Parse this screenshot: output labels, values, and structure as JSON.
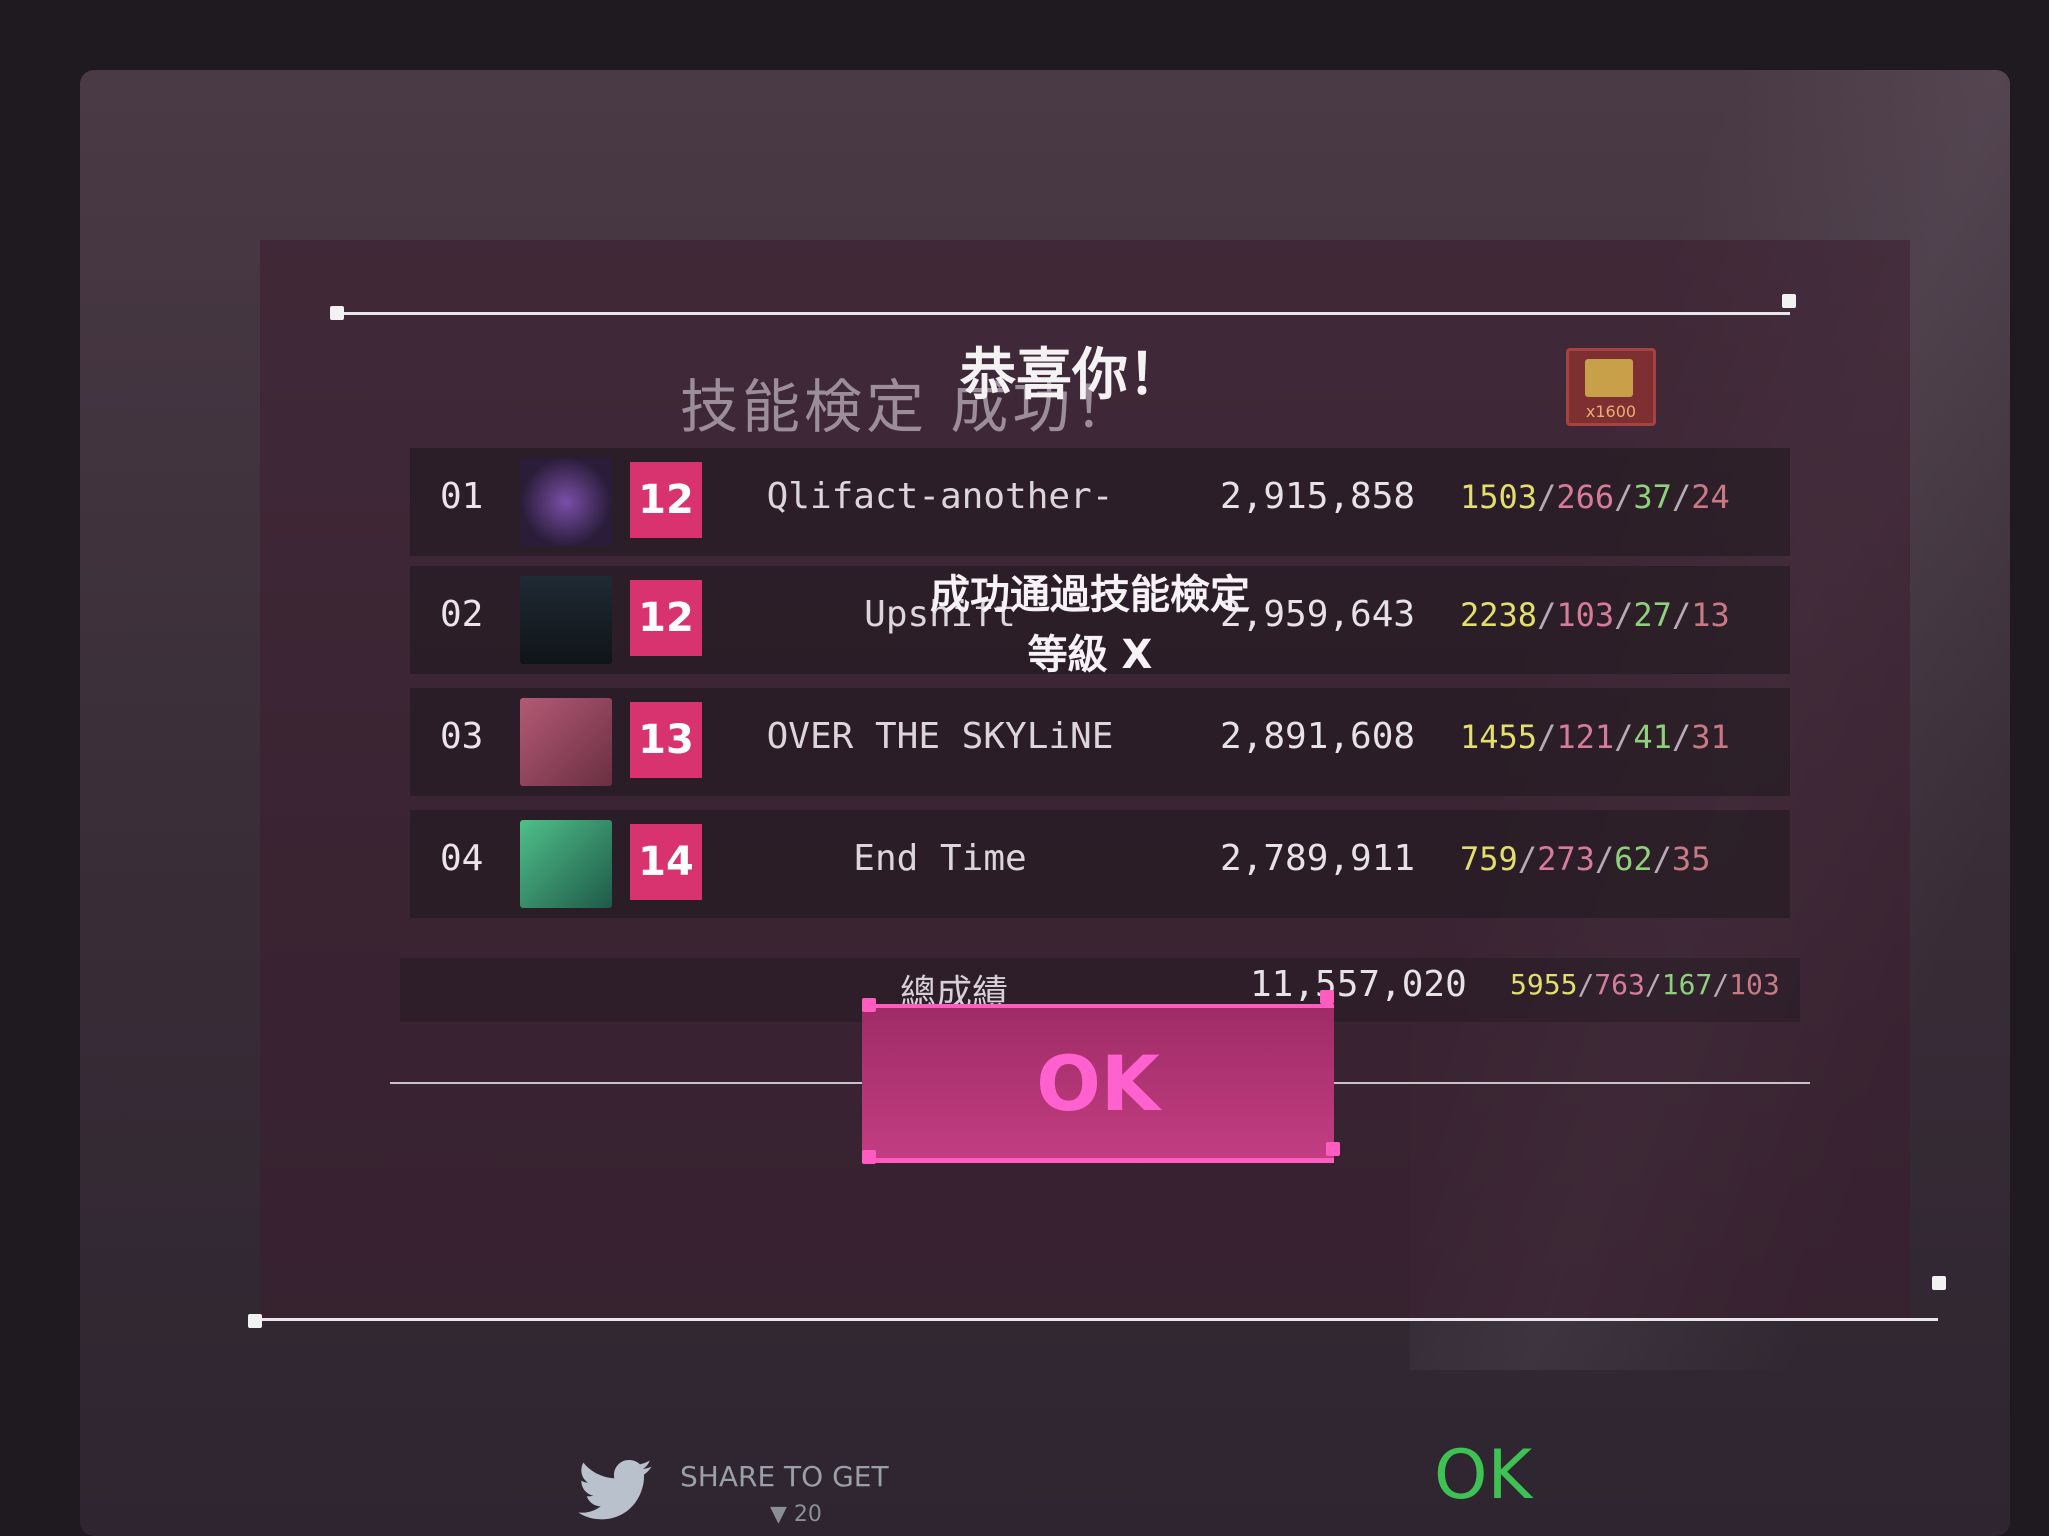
{
  "title_bg": "技能検定 成功！",
  "title_fg": "恭喜你！",
  "coin_label": "x1600",
  "message": {
    "line1": "成功通過技能檢定",
    "line2": "等級 X"
  },
  "rows": [
    {
      "rank": "01",
      "level": "12",
      "song": "Qlifact-another-",
      "score": "2,915,858",
      "judge": [
        "1503",
        "266",
        "37",
        "24"
      ]
    },
    {
      "rank": "02",
      "level": "12",
      "song": "Upshift",
      "score": "2,959,643",
      "judge": [
        "2238",
        "103",
        "27",
        "13"
      ]
    },
    {
      "rank": "03",
      "level": "13",
      "song": "OVER THE SKYLiNE",
      "score": "2,891,608",
      "judge": [
        "1455",
        "121",
        "41",
        "31"
      ]
    },
    {
      "rank": "04",
      "level": "14",
      "song": "End Time",
      "score": "2,789,911",
      "judge": [
        "759",
        "273",
        "62",
        "35"
      ]
    }
  ],
  "total": {
    "label": "總成績",
    "score": "11,557,020",
    "judge": [
      "5955",
      "763",
      "167",
      "103"
    ]
  },
  "ok_button": "OK",
  "share": {
    "text": "SHARE TO GET",
    "sub": "▼ 20"
  },
  "ok_bottom": "OK",
  "colors": {
    "accent": "#ff62cf",
    "level_bg": "#d8326f",
    "green": "#3fc254"
  }
}
